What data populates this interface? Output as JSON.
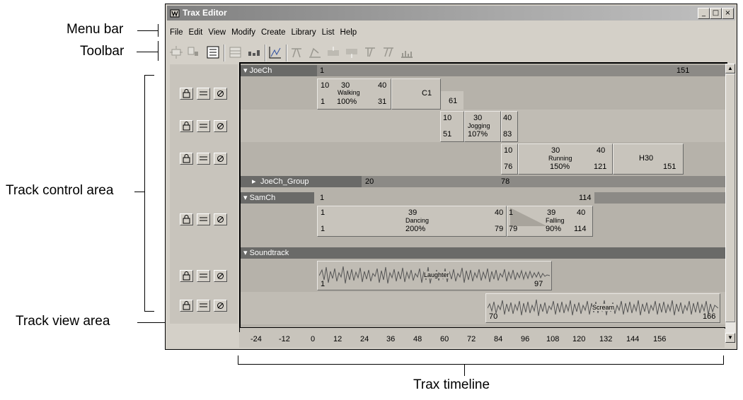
{
  "callouts": {
    "menu_bar": "Menu bar",
    "toolbar": "Toolbar",
    "track_control_area": "Track control area",
    "track_view_area": "Track view area",
    "trax_timeline": "Trax timeline"
  },
  "window": {
    "title": "Trax Editor",
    "minimize": "_",
    "maximize": "□",
    "close": "×"
  },
  "menu": [
    "File",
    "Edit",
    "View",
    "Modify",
    "Create",
    "Library",
    "List",
    "Help"
  ],
  "toolbar_icons": [
    "frame-all-icon",
    "frame-selection-icon",
    "outliner-icon",
    "frame-playback-icon",
    "graph-anim-icon",
    "graph-curve-icon",
    "create-clip-icon",
    "create-pose-icon",
    "insert-clip-icon",
    "add-relative-icon",
    "split-clip-icon",
    "merge-clip-icon",
    "dopesheet-icon"
  ],
  "tracks": {
    "joech": {
      "name": "JoeCh",
      "start": "1",
      "end": "151"
    },
    "joech_group": {
      "name": "JoeCh_Group",
      "a": "20",
      "b": "78"
    },
    "samch": {
      "name": "SamCh",
      "start": "1",
      "end": "114"
    },
    "soundtrack": {
      "name": "Soundtrack"
    }
  },
  "clips": {
    "walking": {
      "a": "10",
      "b": "30",
      "c": "40",
      "name": "Walking",
      "start": "1",
      "pct": "100%",
      "end": "31"
    },
    "c1": {
      "name": "C1",
      "end": "61"
    },
    "jogging": {
      "a": "10",
      "b": "30",
      "c": "40",
      "name": "Jogging",
      "start": "51",
      "pct": "107%",
      "end": "83"
    },
    "running": {
      "a": "10",
      "b": "30",
      "c": "40",
      "name": "Running",
      "start": "76",
      "pct": "150%",
      "end": "121"
    },
    "h30": {
      "name": "H30",
      "end": "151"
    },
    "dancing": {
      "a": "1",
      "b": "39",
      "c": "40",
      "name": "Dancing",
      "start": "1",
      "pct": "200%",
      "end": "79"
    },
    "falling": {
      "a": "1",
      "b": "39",
      "c": "40",
      "name": "Falling",
      "start": "79",
      "pct": "90%",
      "end": "114"
    },
    "laughter": {
      "name": "Laughter",
      "start": "1",
      "end": "97"
    },
    "scream": {
      "name": "Scream",
      "start": "70",
      "end": "166"
    }
  },
  "timeline": [
    "-24",
    "-12",
    "0",
    "12",
    "24",
    "36",
    "48",
    "60",
    "72",
    "84",
    "96",
    "108",
    "120",
    "132",
    "144",
    "156"
  ],
  "colors": {
    "header": "#6a6a68",
    "clip": "#c8c4bc",
    "track": "#b6b2aa",
    "window": "#d4d0c8"
  }
}
